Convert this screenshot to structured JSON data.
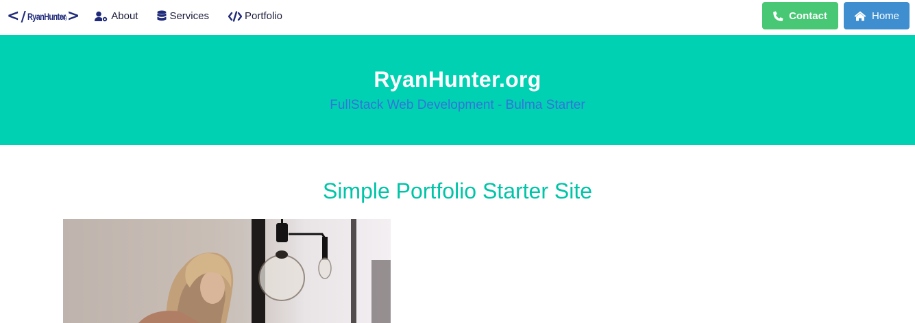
{
  "brand": {
    "open": "<",
    "slash": "/",
    "name": "RyanHunter",
    "tld": ".org",
    "close": ">"
  },
  "nav": {
    "items": [
      {
        "label": "About",
        "icon": "user-gear-icon"
      },
      {
        "label": "Services",
        "icon": "database-icon"
      },
      {
        "label": "Portfolio",
        "icon": "code-icon"
      }
    ],
    "contact_label": "Contact",
    "home_label": "Home"
  },
  "hero": {
    "title": "RyanHunter.org",
    "subtitle": "FullStack Web Development - Bulma Starter"
  },
  "section": {
    "title": "Simple Portfolio Starter Site"
  },
  "colors": {
    "primary": "#00d1b2",
    "success": "#48c774",
    "info": "#3e8ed0",
    "link": "#3273dc"
  }
}
